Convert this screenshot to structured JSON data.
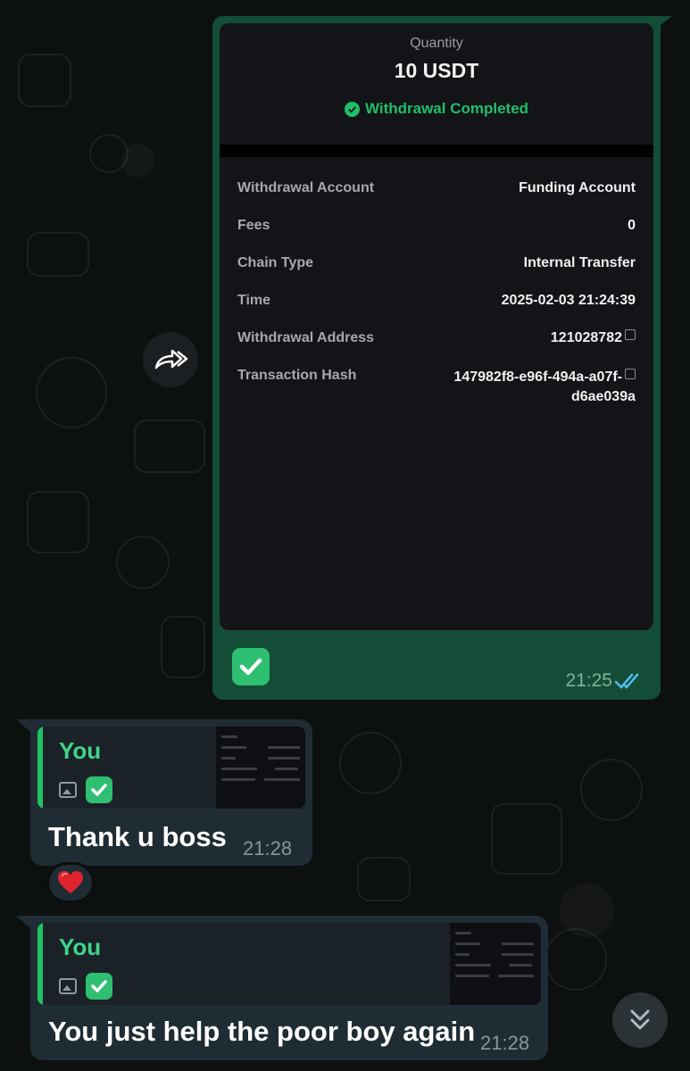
{
  "transfer_screenshot": {
    "quantity_label": "Quantity",
    "amount": "10 USDT",
    "status": "Withdrawal Completed",
    "details": [
      {
        "label": "Withdrawal Account",
        "value": "Funding Account"
      },
      {
        "label": "Fees",
        "value": "0"
      },
      {
        "label": "Chain Type",
        "value": "Internal Transfer"
      },
      {
        "label": "Time",
        "value": "2025-02-03 21:24:39"
      },
      {
        "label": "Withdrawal Address",
        "value": "121028782"
      },
      {
        "label": "Transaction Hash",
        "value_line1": "147982f8-e96f-494a-a07f-",
        "value_line2": "d6ae039a"
      }
    ]
  },
  "outgoing_message": {
    "emoji": "check-mark-button",
    "time": "21:25",
    "status": "read"
  },
  "reply_1": {
    "quoted_author": "You",
    "text": "Thank u boss",
    "time": "21:28",
    "reaction": "❤️"
  },
  "reply_2": {
    "quoted_author": "You",
    "text": "You just help the poor boy again",
    "time": "21:28"
  },
  "colors": {
    "outgoing_bubble": "#144d37",
    "incoming_bubble": "#1f2c33",
    "accent_green": "#21c063",
    "read_ticks": "#53bdeb"
  },
  "icons": [
    "forward-icon",
    "copy-icon",
    "photo-icon",
    "check-mark-icon",
    "double-check-icon",
    "chevron-double-down-icon"
  ]
}
